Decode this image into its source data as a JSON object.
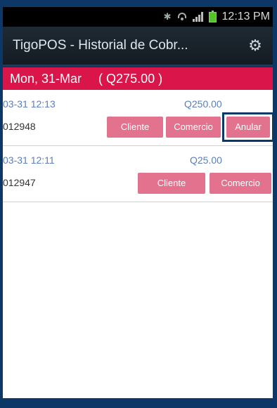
{
  "status_bar": {
    "time": "12:13 PM",
    "icons": [
      "bluetooth-icon",
      "wifi-icon",
      "signal-icon",
      "battery-icon"
    ]
  },
  "app_bar": {
    "title": "TigoPOS - Historial de Cobr...",
    "settings_icon": "gear-icon"
  },
  "date_header": {
    "date": "Mon, 31-Mar",
    "total": "( Q275.00 )"
  },
  "transactions": [
    {
      "time": "03-31 12:13",
      "amount": "Q250.00",
      "number": "012948",
      "buttons": [
        "Cliente",
        "Comercio",
        "Anular"
      ]
    },
    {
      "time": "03-31 12:11",
      "amount": "Q25.00",
      "number": "012947",
      "buttons": [
        "Cliente",
        "Comercio"
      ]
    }
  ],
  "colors": {
    "frame": "#0d3766",
    "date_header_bg": "#d9154a",
    "button_bg": "#e2728e",
    "link_text": "#5a7fb8"
  }
}
